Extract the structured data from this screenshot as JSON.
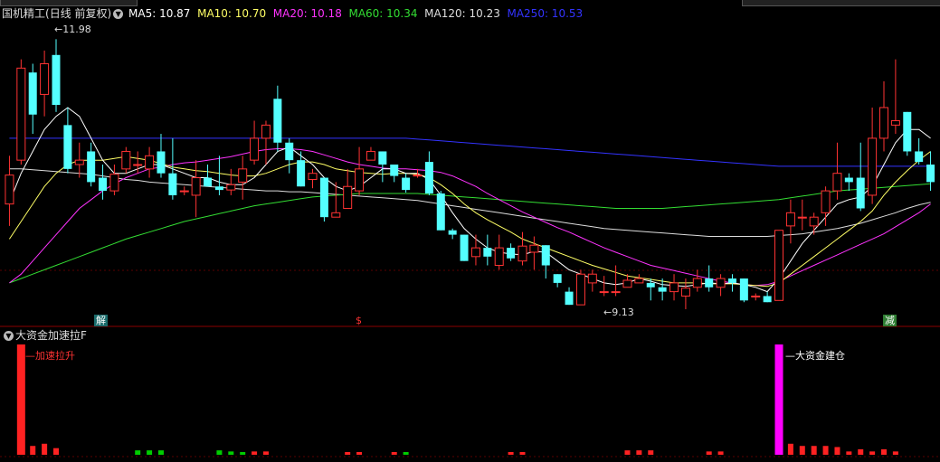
{
  "main_panel": {
    "stock_name": "国机精工",
    "period_label": "(日线 前复权)",
    "indicators": [
      {
        "label": "MA5: 10.87",
        "color": "#ffffff"
      },
      {
        "label": "MA10: 10.70",
        "color": "#ffff66"
      },
      {
        "label": "MA20: 10.18",
        "color": "#ff33ff"
      },
      {
        "label": "MA60: 10.34",
        "color": "#33dd33"
      },
      {
        "label": "MA120: 10.23",
        "color": "#dddddd"
      },
      {
        "label": "MA250: 10.53",
        "color": "#3333ff"
      }
    ],
    "high_marker": "11.98",
    "low_marker": "9.13",
    "event_tags": [
      "解",
      "$",
      "减"
    ]
  },
  "sub_panel": {
    "indicator_name": "大资金加速拉F",
    "annotation_1": "加速拉升",
    "annotation_2": "大资金建仓"
  },
  "colors": {
    "up": "#ff3333",
    "down": "#54ffff",
    "pink": "#ff00ff",
    "green": "#00cc00",
    "grid": "#8b0000",
    "ma250": "#3333ff"
  },
  "chart_data": {
    "type": "candlestick",
    "price_range": [
      8.9,
      12.2
    ],
    "candles": [
      [
        10.1,
        10.43,
        10.65,
        9.85
      ],
      [
        10.6,
        11.65,
        11.75,
        10.55
      ],
      [
        11.6,
        11.12,
        11.7,
        10.9
      ],
      [
        11.35,
        11.7,
        11.85,
        11.1
      ],
      [
        11.8,
        11.23,
        11.98,
        11.15
      ],
      [
        11.0,
        10.5,
        11.2,
        10.45
      ],
      [
        10.55,
        10.6,
        10.8,
        10.4
      ],
      [
        10.7,
        10.35,
        10.8,
        10.3
      ],
      [
        10.4,
        10.25,
        10.55,
        10.15
      ],
      [
        10.25,
        10.44,
        10.55,
        10.2
      ],
      [
        10.5,
        10.7,
        10.75,
        10.45
      ],
      [
        10.55,
        10.55,
        10.7,
        10.45
      ],
      [
        10.5,
        10.65,
        10.75,
        10.4
      ],
      [
        10.7,
        10.45,
        10.9,
        10.4
      ],
      [
        10.45,
        10.2,
        10.85,
        10.15
      ],
      [
        10.25,
        10.25,
        10.3,
        10.2
      ],
      [
        10.2,
        10.4,
        10.6,
        9.95
      ],
      [
        10.4,
        10.3,
        10.55,
        10.3
      ],
      [
        10.3,
        10.26,
        10.65,
        10.2
      ],
      [
        10.26,
        10.32,
        10.5,
        10.2
      ],
      [
        10.35,
        10.5,
        10.65,
        10.15
      ],
      [
        10.6,
        10.85,
        11.05,
        10.55
      ],
      [
        10.85,
        11.0,
        11.05,
        10.55
      ],
      [
        11.3,
        10.8,
        11.45,
        10.7
      ],
      [
        10.8,
        10.6,
        10.85,
        10.45
      ],
      [
        10.6,
        10.3,
        10.7,
        10.3
      ],
      [
        10.38,
        10.45,
        10.5,
        10.28
      ],
      [
        10.4,
        9.95,
        10.4,
        9.9
      ],
      [
        9.95,
        10.0,
        10.35,
        9.95
      ],
      [
        10.05,
        10.3,
        10.5,
        10.05
      ],
      [
        10.25,
        10.5,
        10.75,
        10.2
      ],
      [
        10.6,
        10.7,
        10.75,
        10.6
      ],
      [
        10.7,
        10.55,
        10.7,
        10.35
      ],
      [
        10.55,
        10.42,
        10.55,
        10.35
      ],
      [
        10.4,
        10.26,
        10.45,
        10.23
      ],
      [
        10.43,
        10.43,
        10.5,
        10.4
      ],
      [
        10.58,
        10.22,
        10.7,
        10.2
      ],
      [
        10.22,
        9.8,
        10.25,
        9.8
      ],
      [
        9.8,
        9.75,
        9.82,
        9.7
      ],
      [
        9.75,
        9.45,
        9.75,
        9.45
      ],
      [
        9.5,
        9.6,
        9.75,
        9.4
      ],
      [
        9.6,
        9.5,
        9.75,
        9.4
      ],
      [
        9.4,
        9.6,
        9.75,
        9.35
      ],
      [
        9.6,
        9.48,
        9.65,
        9.45
      ],
      [
        9.45,
        9.62,
        9.78,
        9.4
      ],
      [
        9.55,
        9.63,
        9.73,
        9.35
      ],
      [
        9.63,
        9.4,
        9.63,
        9.25
      ],
      [
        9.3,
        9.2,
        9.3,
        9.15
      ],
      [
        9.1,
        8.95,
        9.15,
        8.95
      ],
      [
        8.95,
        9.3,
        9.35,
        8.95
      ],
      [
        9.2,
        9.3,
        9.35,
        9.1
      ],
      [
        9.1,
        9.1,
        9.28,
        9.05
      ],
      [
        9.1,
        9.1,
        9.4,
        9.05
      ],
      [
        9.15,
        9.23,
        9.3,
        9.15
      ],
      [
        9.2,
        9.25,
        9.3,
        9.2
      ],
      [
        9.2,
        9.15,
        9.25,
        9.0
      ],
      [
        9.15,
        9.1,
        9.25,
        9.0
      ],
      [
        9.1,
        9.2,
        9.3,
        9.0
      ],
      [
        9.05,
        9.14,
        9.25,
        8.9
      ],
      [
        9.15,
        9.25,
        9.35,
        9.1
      ],
      [
        9.25,
        9.15,
        9.4,
        9.1
      ],
      [
        9.15,
        9.25,
        9.3,
        9.05
      ],
      [
        9.25,
        9.2,
        9.3,
        9.1
      ],
      [
        9.25,
        9.0,
        9.25,
        8.98
      ],
      [
        9.05,
        9.05,
        9.08,
        9.0
      ],
      [
        9.05,
        8.98,
        9.1,
        8.98
      ],
      [
        9.0,
        9.8,
        9.8,
        9.0
      ],
      [
        9.85,
        10.0,
        10.15,
        9.65
      ],
      [
        9.95,
        9.95,
        10.15,
        9.8
      ],
      [
        9.85,
        9.95,
        10.0,
        9.75
      ],
      [
        10.0,
        10.25,
        10.3,
        9.85
      ],
      [
        10.25,
        10.45,
        10.8,
        10.15
      ],
      [
        10.4,
        10.35,
        10.45,
        10.25
      ],
      [
        10.4,
        10.05,
        10.8,
        10.02
      ],
      [
        10.2,
        10.85,
        11.2,
        10.1
      ],
      [
        10.85,
        11.2,
        11.5,
        10.7
      ],
      [
        11.0,
        11.05,
        11.75,
        10.9
      ],
      [
        11.15,
        10.7,
        11.15,
        10.65
      ],
      [
        10.7,
        10.58,
        10.85,
        10.55
      ],
      [
        10.55,
        10.35,
        10.7,
        10.25
      ]
    ],
    "ma5": [
      10.12,
      10.45,
      10.7,
      10.95,
      11.1,
      11.2,
      11.1,
      10.85,
      10.6,
      10.45,
      10.45,
      10.5,
      10.55,
      10.55,
      10.5,
      10.45,
      10.4,
      10.4,
      10.35,
      10.32,
      10.32,
      10.4,
      10.55,
      10.7,
      10.75,
      10.65,
      10.55,
      10.4,
      10.3,
      10.25,
      10.3,
      10.4,
      10.5,
      10.5,
      10.45,
      10.45,
      10.38,
      10.2,
      10.0,
      9.82,
      9.7,
      9.6,
      9.55,
      9.53,
      9.52,
      9.56,
      9.55,
      9.45,
      9.35,
      9.3,
      9.25,
      9.2,
      9.18,
      9.2,
      9.25,
      9.22,
      9.18,
      9.17,
      9.16,
      9.18,
      9.2,
      9.19,
      9.2,
      9.18,
      9.15,
      9.1,
      9.25,
      9.45,
      9.65,
      9.8,
      9.95,
      10.1,
      10.15,
      10.18,
      10.3,
      10.55,
      10.8,
      10.95,
      10.95,
      10.85
    ],
    "ma10": [
      9.7,
      9.9,
      10.1,
      10.3,
      10.45,
      10.55,
      10.6,
      10.6,
      10.6,
      10.62,
      10.64,
      10.62,
      10.6,
      10.56,
      10.52,
      10.5,
      10.48,
      10.47,
      10.45,
      10.43,
      10.42,
      10.42,
      10.45,
      10.5,
      10.55,
      10.58,
      10.58,
      10.55,
      10.5,
      10.48,
      10.46,
      10.45,
      10.44,
      10.45,
      10.45,
      10.44,
      10.4,
      10.32,
      10.22,
      10.1,
      10.0,
      9.92,
      9.85,
      9.78,
      9.7,
      9.65,
      9.6,
      9.55,
      9.5,
      9.45,
      9.4,
      9.36,
      9.32,
      9.28,
      9.26,
      9.24,
      9.22,
      9.2,
      9.2,
      9.2,
      9.19,
      9.19,
      9.19,
      9.18,
      9.17,
      9.16,
      9.2,
      9.3,
      9.4,
      9.5,
      9.6,
      9.7,
      9.8,
      9.9,
      10.02,
      10.2,
      10.35,
      10.48,
      10.6,
      10.7
    ],
    "ma20": [
      9.2,
      9.3,
      9.45,
      9.6,
      9.75,
      9.9,
      10.05,
      10.15,
      10.25,
      10.33,
      10.4,
      10.45,
      10.5,
      10.52,
      10.55,
      10.57,
      10.58,
      10.6,
      10.62,
      10.64,
      10.67,
      10.7,
      10.72,
      10.73,
      10.73,
      10.72,
      10.7,
      10.66,
      10.62,
      10.58,
      10.55,
      10.53,
      10.51,
      10.5,
      10.5,
      10.49,
      10.48,
      10.46,
      10.42,
      10.36,
      10.3,
      10.22,
      10.15,
      10.08,
      10.01,
      9.95,
      9.89,
      9.83,
      9.78,
      9.72,
      9.66,
      9.6,
      9.55,
      9.5,
      9.45,
      9.4,
      9.37,
      9.34,
      9.31,
      9.28,
      9.25,
      9.22,
      9.2,
      9.18,
      9.17,
      9.18,
      9.22,
      9.28,
      9.34,
      9.4,
      9.46,
      9.52,
      9.58,
      9.64,
      9.7,
      9.76,
      9.84,
      9.92,
      10.0,
      10.1
    ],
    "ma60": [
      9.2,
      9.25,
      9.3,
      9.35,
      9.4,
      9.45,
      9.5,
      9.55,
      9.6,
      9.65,
      9.7,
      9.74,
      9.78,
      9.82,
      9.86,
      9.9,
      9.93,
      9.96,
      9.99,
      10.02,
      10.05,
      10.08,
      10.1,
      10.12,
      10.14,
      10.16,
      10.18,
      10.19,
      10.2,
      10.21,
      10.22,
      10.22,
      10.22,
      10.22,
      10.22,
      10.22,
      10.21,
      10.2,
      10.19,
      10.18,
      10.17,
      10.16,
      10.15,
      10.14,
      10.13,
      10.12,
      10.11,
      10.1,
      10.09,
      10.08,
      10.07,
      10.06,
      10.05,
      10.05,
      10.05,
      10.05,
      10.05,
      10.06,
      10.07,
      10.08,
      10.09,
      10.1,
      10.11,
      10.12,
      10.13,
      10.14,
      10.15,
      10.17,
      10.19,
      10.21,
      10.23,
      10.25,
      10.26,
      10.27,
      10.28,
      10.29,
      10.3,
      10.31,
      10.32,
      10.33
    ],
    "ma120": [
      10.5,
      10.5,
      10.49,
      10.48,
      10.47,
      10.46,
      10.45,
      10.44,
      10.42,
      10.4,
      10.38,
      10.37,
      10.35,
      10.34,
      10.33,
      10.32,
      10.31,
      10.3,
      10.29,
      10.28,
      10.27,
      10.26,
      10.25,
      10.25,
      10.24,
      10.24,
      10.23,
      10.22,
      10.21,
      10.2,
      10.19,
      10.18,
      10.17,
      10.16,
      10.15,
      10.14,
      10.12,
      10.1,
      10.08,
      10.06,
      10.04,
      10.02,
      10.0,
      9.98,
      9.96,
      9.94,
      9.92,
      9.9,
      9.88,
      9.86,
      9.84,
      9.82,
      9.81,
      9.8,
      9.79,
      9.78,
      9.77,
      9.76,
      9.75,
      9.74,
      9.73,
      9.73,
      9.73,
      9.73,
      9.73,
      9.73,
      9.74,
      9.75,
      9.76,
      9.78,
      9.8,
      9.82,
      9.85,
      9.88,
      9.92,
      9.96,
      10.0,
      10.05,
      10.09,
      10.12
    ],
    "ma250": [
      10.85,
      10.85,
      10.85,
      10.85,
      10.85,
      10.85,
      10.85,
      10.85,
      10.85,
      10.85,
      10.85,
      10.85,
      10.85,
      10.85,
      10.85,
      10.85,
      10.85,
      10.85,
      10.85,
      10.85,
      10.85,
      10.85,
      10.85,
      10.85,
      10.85,
      10.85,
      10.85,
      10.85,
      10.85,
      10.85,
      10.85,
      10.85,
      10.85,
      10.85,
      10.85,
      10.84,
      10.83,
      10.82,
      10.81,
      10.8,
      10.79,
      10.78,
      10.77,
      10.76,
      10.75,
      10.74,
      10.73,
      10.72,
      10.71,
      10.7,
      10.69,
      10.68,
      10.67,
      10.66,
      10.65,
      10.64,
      10.63,
      10.62,
      10.61,
      10.6,
      10.59,
      10.58,
      10.57,
      10.56,
      10.55,
      10.54,
      10.53,
      10.53,
      10.53,
      10.53,
      10.53,
      10.53,
      10.53,
      10.53,
      10.53,
      10.53,
      10.53,
      10.53,
      10.53,
      10.53
    ],
    "sub_bars": [
      {
        "i": 1,
        "v": 1.0,
        "c": "red"
      },
      {
        "i": 2,
        "v": 0.08,
        "c": "red"
      },
      {
        "i": 3,
        "v": 0.1,
        "c": "red"
      },
      {
        "i": 4,
        "v": 0.06,
        "c": "red"
      },
      {
        "i": 11,
        "v": 0.04,
        "c": "green"
      },
      {
        "i": 12,
        "v": 0.04,
        "c": "green"
      },
      {
        "i": 13,
        "v": 0.04,
        "c": "green"
      },
      {
        "i": 18,
        "v": 0.04,
        "c": "green"
      },
      {
        "i": 19,
        "v": 0.03,
        "c": "green"
      },
      {
        "i": 20,
        "v": 0.02,
        "c": "green"
      },
      {
        "i": 21,
        "v": 0.03,
        "c": "red"
      },
      {
        "i": 22,
        "v": 0.03,
        "c": "red"
      },
      {
        "i": 29,
        "v": 0.02,
        "c": "red"
      },
      {
        "i": 30,
        "v": 0.02,
        "c": "red"
      },
      {
        "i": 33,
        "v": 0.02,
        "c": "red"
      },
      {
        "i": 34,
        "v": 0.02,
        "c": "green"
      },
      {
        "i": 43,
        "v": 0.02,
        "c": "red"
      },
      {
        "i": 44,
        "v": 0.02,
        "c": "red"
      },
      {
        "i": 53,
        "v": 0.04,
        "c": "red"
      },
      {
        "i": 54,
        "v": 0.04,
        "c": "red"
      },
      {
        "i": 55,
        "v": 0.04,
        "c": "red"
      },
      {
        "i": 60,
        "v": 0.03,
        "c": "red"
      },
      {
        "i": 61,
        "v": 0.03,
        "c": "red"
      },
      {
        "i": 66,
        "v": 1.0,
        "c": "pink"
      },
      {
        "i": 67,
        "v": 0.1,
        "c": "red"
      },
      {
        "i": 68,
        "v": 0.08,
        "c": "red"
      },
      {
        "i": 69,
        "v": 0.08,
        "c": "red"
      },
      {
        "i": 70,
        "v": 0.08,
        "c": "red"
      },
      {
        "i": 71,
        "v": 0.07,
        "c": "red"
      },
      {
        "i": 72,
        "v": 0.03,
        "c": "red"
      },
      {
        "i": 73,
        "v": 0.05,
        "c": "red"
      },
      {
        "i": 74,
        "v": 0.03,
        "c": "red"
      },
      {
        "i": 75,
        "v": 0.05,
        "c": "red"
      },
      {
        "i": 76,
        "v": 0.03,
        "c": "red"
      }
    ]
  }
}
